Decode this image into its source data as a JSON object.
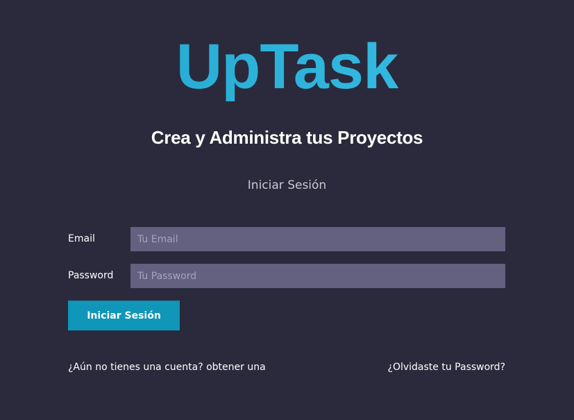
{
  "brand": {
    "logo_text": "UpTask",
    "tagline": "Crea y Administra tus Proyectos"
  },
  "form": {
    "title": "Iniciar Sesión",
    "email": {
      "label": "Email",
      "placeholder": "Tu Email",
      "value": ""
    },
    "password": {
      "label": "Password",
      "placeholder": "Tu Password",
      "value": ""
    },
    "submit_label": "Iniciar Sesión"
  },
  "links": {
    "register": "¿Aún no tienes una cuenta? obtener una",
    "forgot_password": "¿Olvidaste tu Password?"
  },
  "colors": {
    "background": "#2a2a3c",
    "accent": "#0f96b8",
    "logo": "#28acd6",
    "input_background": "#636080"
  }
}
